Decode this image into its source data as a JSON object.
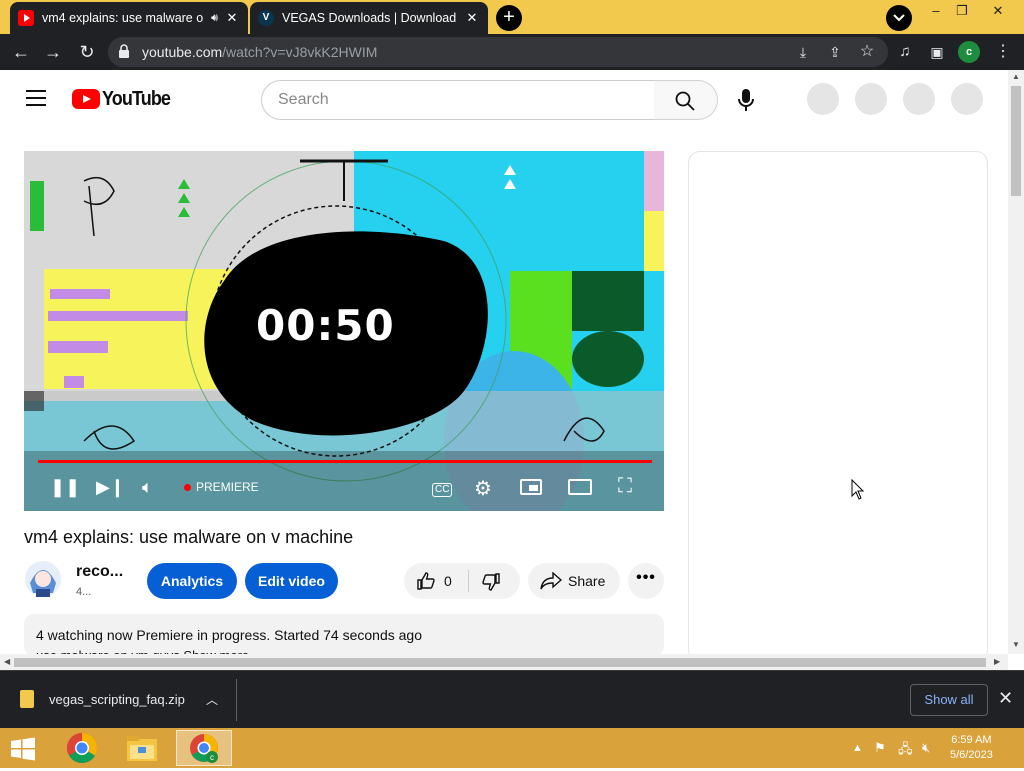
{
  "browser": {
    "tabs": [
      {
        "title": "vm4 explains: use malware o",
        "favicon": "youtube-icon",
        "audio": true
      },
      {
        "title": "VEGAS Downloads | Download in",
        "favicon": "vegas-icon"
      }
    ],
    "address": {
      "domain": "youtube.com",
      "path": "/watch?v=vJ8vkK2HWIM"
    },
    "profile_initial": "c",
    "window_controls": [
      "–",
      "❐",
      "✕"
    ],
    "tab_strip_color": "#f2c94c"
  },
  "youtube": {
    "logo_text": "YouTube",
    "search_placeholder": "Search",
    "player": {
      "countdown": "00:50",
      "premiere_label": "PREMIERE",
      "progress_fraction": 0.96
    },
    "video": {
      "title": "vm4 explains: use malware on v machine",
      "channel_name": "reco...",
      "subscribers": "4...",
      "analytics_label": "Analytics",
      "edit_label": "Edit video",
      "like_count": "0",
      "share_label": "Share",
      "more_label": "•••"
    },
    "description": {
      "line1": "4 watching now  Premiere in progress. Started 74 seconds ago",
      "line2": "use malware on vm guys Show more"
    }
  },
  "downloads": {
    "file_name": "vegas_scripting_faq.zip",
    "show_all_label": "Show all"
  },
  "taskbar": {
    "time": "6:59 AM",
    "date": "5/6/2023",
    "apps": [
      "start-button",
      "chrome-icon",
      "file-explorer-icon",
      "chrome-profile-icon"
    ]
  },
  "colors": {
    "yt_red": "#ff0000",
    "blue_button": "#065fd4",
    "chrome_dark": "#202124",
    "taskbar": "#d9a23a"
  }
}
